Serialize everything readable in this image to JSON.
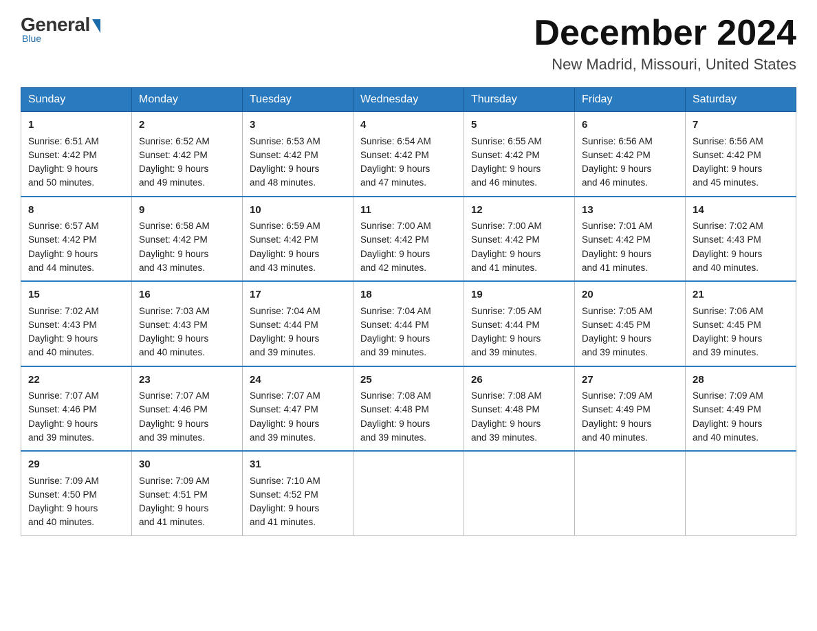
{
  "logo": {
    "general": "General",
    "blue": "Blue",
    "tagline": "Blue"
  },
  "header": {
    "month": "December 2024",
    "location": "New Madrid, Missouri, United States"
  },
  "days_of_week": [
    "Sunday",
    "Monday",
    "Tuesday",
    "Wednesday",
    "Thursday",
    "Friday",
    "Saturday"
  ],
  "weeks": [
    [
      {
        "day": "1",
        "sunrise": "6:51 AM",
        "sunset": "4:42 PM",
        "daylight": "9 hours and 50 minutes."
      },
      {
        "day": "2",
        "sunrise": "6:52 AM",
        "sunset": "4:42 PM",
        "daylight": "9 hours and 49 minutes."
      },
      {
        "day": "3",
        "sunrise": "6:53 AM",
        "sunset": "4:42 PM",
        "daylight": "9 hours and 48 minutes."
      },
      {
        "day": "4",
        "sunrise": "6:54 AM",
        "sunset": "4:42 PM",
        "daylight": "9 hours and 47 minutes."
      },
      {
        "day": "5",
        "sunrise": "6:55 AM",
        "sunset": "4:42 PM",
        "daylight": "9 hours and 46 minutes."
      },
      {
        "day": "6",
        "sunrise": "6:56 AM",
        "sunset": "4:42 PM",
        "daylight": "9 hours and 46 minutes."
      },
      {
        "day": "7",
        "sunrise": "6:56 AM",
        "sunset": "4:42 PM",
        "daylight": "9 hours and 45 minutes."
      }
    ],
    [
      {
        "day": "8",
        "sunrise": "6:57 AM",
        "sunset": "4:42 PM",
        "daylight": "9 hours and 44 minutes."
      },
      {
        "day": "9",
        "sunrise": "6:58 AM",
        "sunset": "4:42 PM",
        "daylight": "9 hours and 43 minutes."
      },
      {
        "day": "10",
        "sunrise": "6:59 AM",
        "sunset": "4:42 PM",
        "daylight": "9 hours and 43 minutes."
      },
      {
        "day": "11",
        "sunrise": "7:00 AM",
        "sunset": "4:42 PM",
        "daylight": "9 hours and 42 minutes."
      },
      {
        "day": "12",
        "sunrise": "7:00 AM",
        "sunset": "4:42 PM",
        "daylight": "9 hours and 41 minutes."
      },
      {
        "day": "13",
        "sunrise": "7:01 AM",
        "sunset": "4:42 PM",
        "daylight": "9 hours and 41 minutes."
      },
      {
        "day": "14",
        "sunrise": "7:02 AM",
        "sunset": "4:43 PM",
        "daylight": "9 hours and 40 minutes."
      }
    ],
    [
      {
        "day": "15",
        "sunrise": "7:02 AM",
        "sunset": "4:43 PM",
        "daylight": "9 hours and 40 minutes."
      },
      {
        "day": "16",
        "sunrise": "7:03 AM",
        "sunset": "4:43 PM",
        "daylight": "9 hours and 40 minutes."
      },
      {
        "day": "17",
        "sunrise": "7:04 AM",
        "sunset": "4:44 PM",
        "daylight": "9 hours and 39 minutes."
      },
      {
        "day": "18",
        "sunrise": "7:04 AM",
        "sunset": "4:44 PM",
        "daylight": "9 hours and 39 minutes."
      },
      {
        "day": "19",
        "sunrise": "7:05 AM",
        "sunset": "4:44 PM",
        "daylight": "9 hours and 39 minutes."
      },
      {
        "day": "20",
        "sunrise": "7:05 AM",
        "sunset": "4:45 PM",
        "daylight": "9 hours and 39 minutes."
      },
      {
        "day": "21",
        "sunrise": "7:06 AM",
        "sunset": "4:45 PM",
        "daylight": "9 hours and 39 minutes."
      }
    ],
    [
      {
        "day": "22",
        "sunrise": "7:07 AM",
        "sunset": "4:46 PM",
        "daylight": "9 hours and 39 minutes."
      },
      {
        "day": "23",
        "sunrise": "7:07 AM",
        "sunset": "4:46 PM",
        "daylight": "9 hours and 39 minutes."
      },
      {
        "day": "24",
        "sunrise": "7:07 AM",
        "sunset": "4:47 PM",
        "daylight": "9 hours and 39 minutes."
      },
      {
        "day": "25",
        "sunrise": "7:08 AM",
        "sunset": "4:48 PM",
        "daylight": "9 hours and 39 minutes."
      },
      {
        "day": "26",
        "sunrise": "7:08 AM",
        "sunset": "4:48 PM",
        "daylight": "9 hours and 39 minutes."
      },
      {
        "day": "27",
        "sunrise": "7:09 AM",
        "sunset": "4:49 PM",
        "daylight": "9 hours and 40 minutes."
      },
      {
        "day": "28",
        "sunrise": "7:09 AM",
        "sunset": "4:49 PM",
        "daylight": "9 hours and 40 minutes."
      }
    ],
    [
      {
        "day": "29",
        "sunrise": "7:09 AM",
        "sunset": "4:50 PM",
        "daylight": "9 hours and 40 minutes."
      },
      {
        "day": "30",
        "sunrise": "7:09 AM",
        "sunset": "4:51 PM",
        "daylight": "9 hours and 41 minutes."
      },
      {
        "day": "31",
        "sunrise": "7:10 AM",
        "sunset": "4:52 PM",
        "daylight": "9 hours and 41 minutes."
      },
      null,
      null,
      null,
      null
    ]
  ],
  "labels": {
    "sunrise": "Sunrise:",
    "sunset": "Sunset:",
    "daylight": "Daylight:"
  }
}
